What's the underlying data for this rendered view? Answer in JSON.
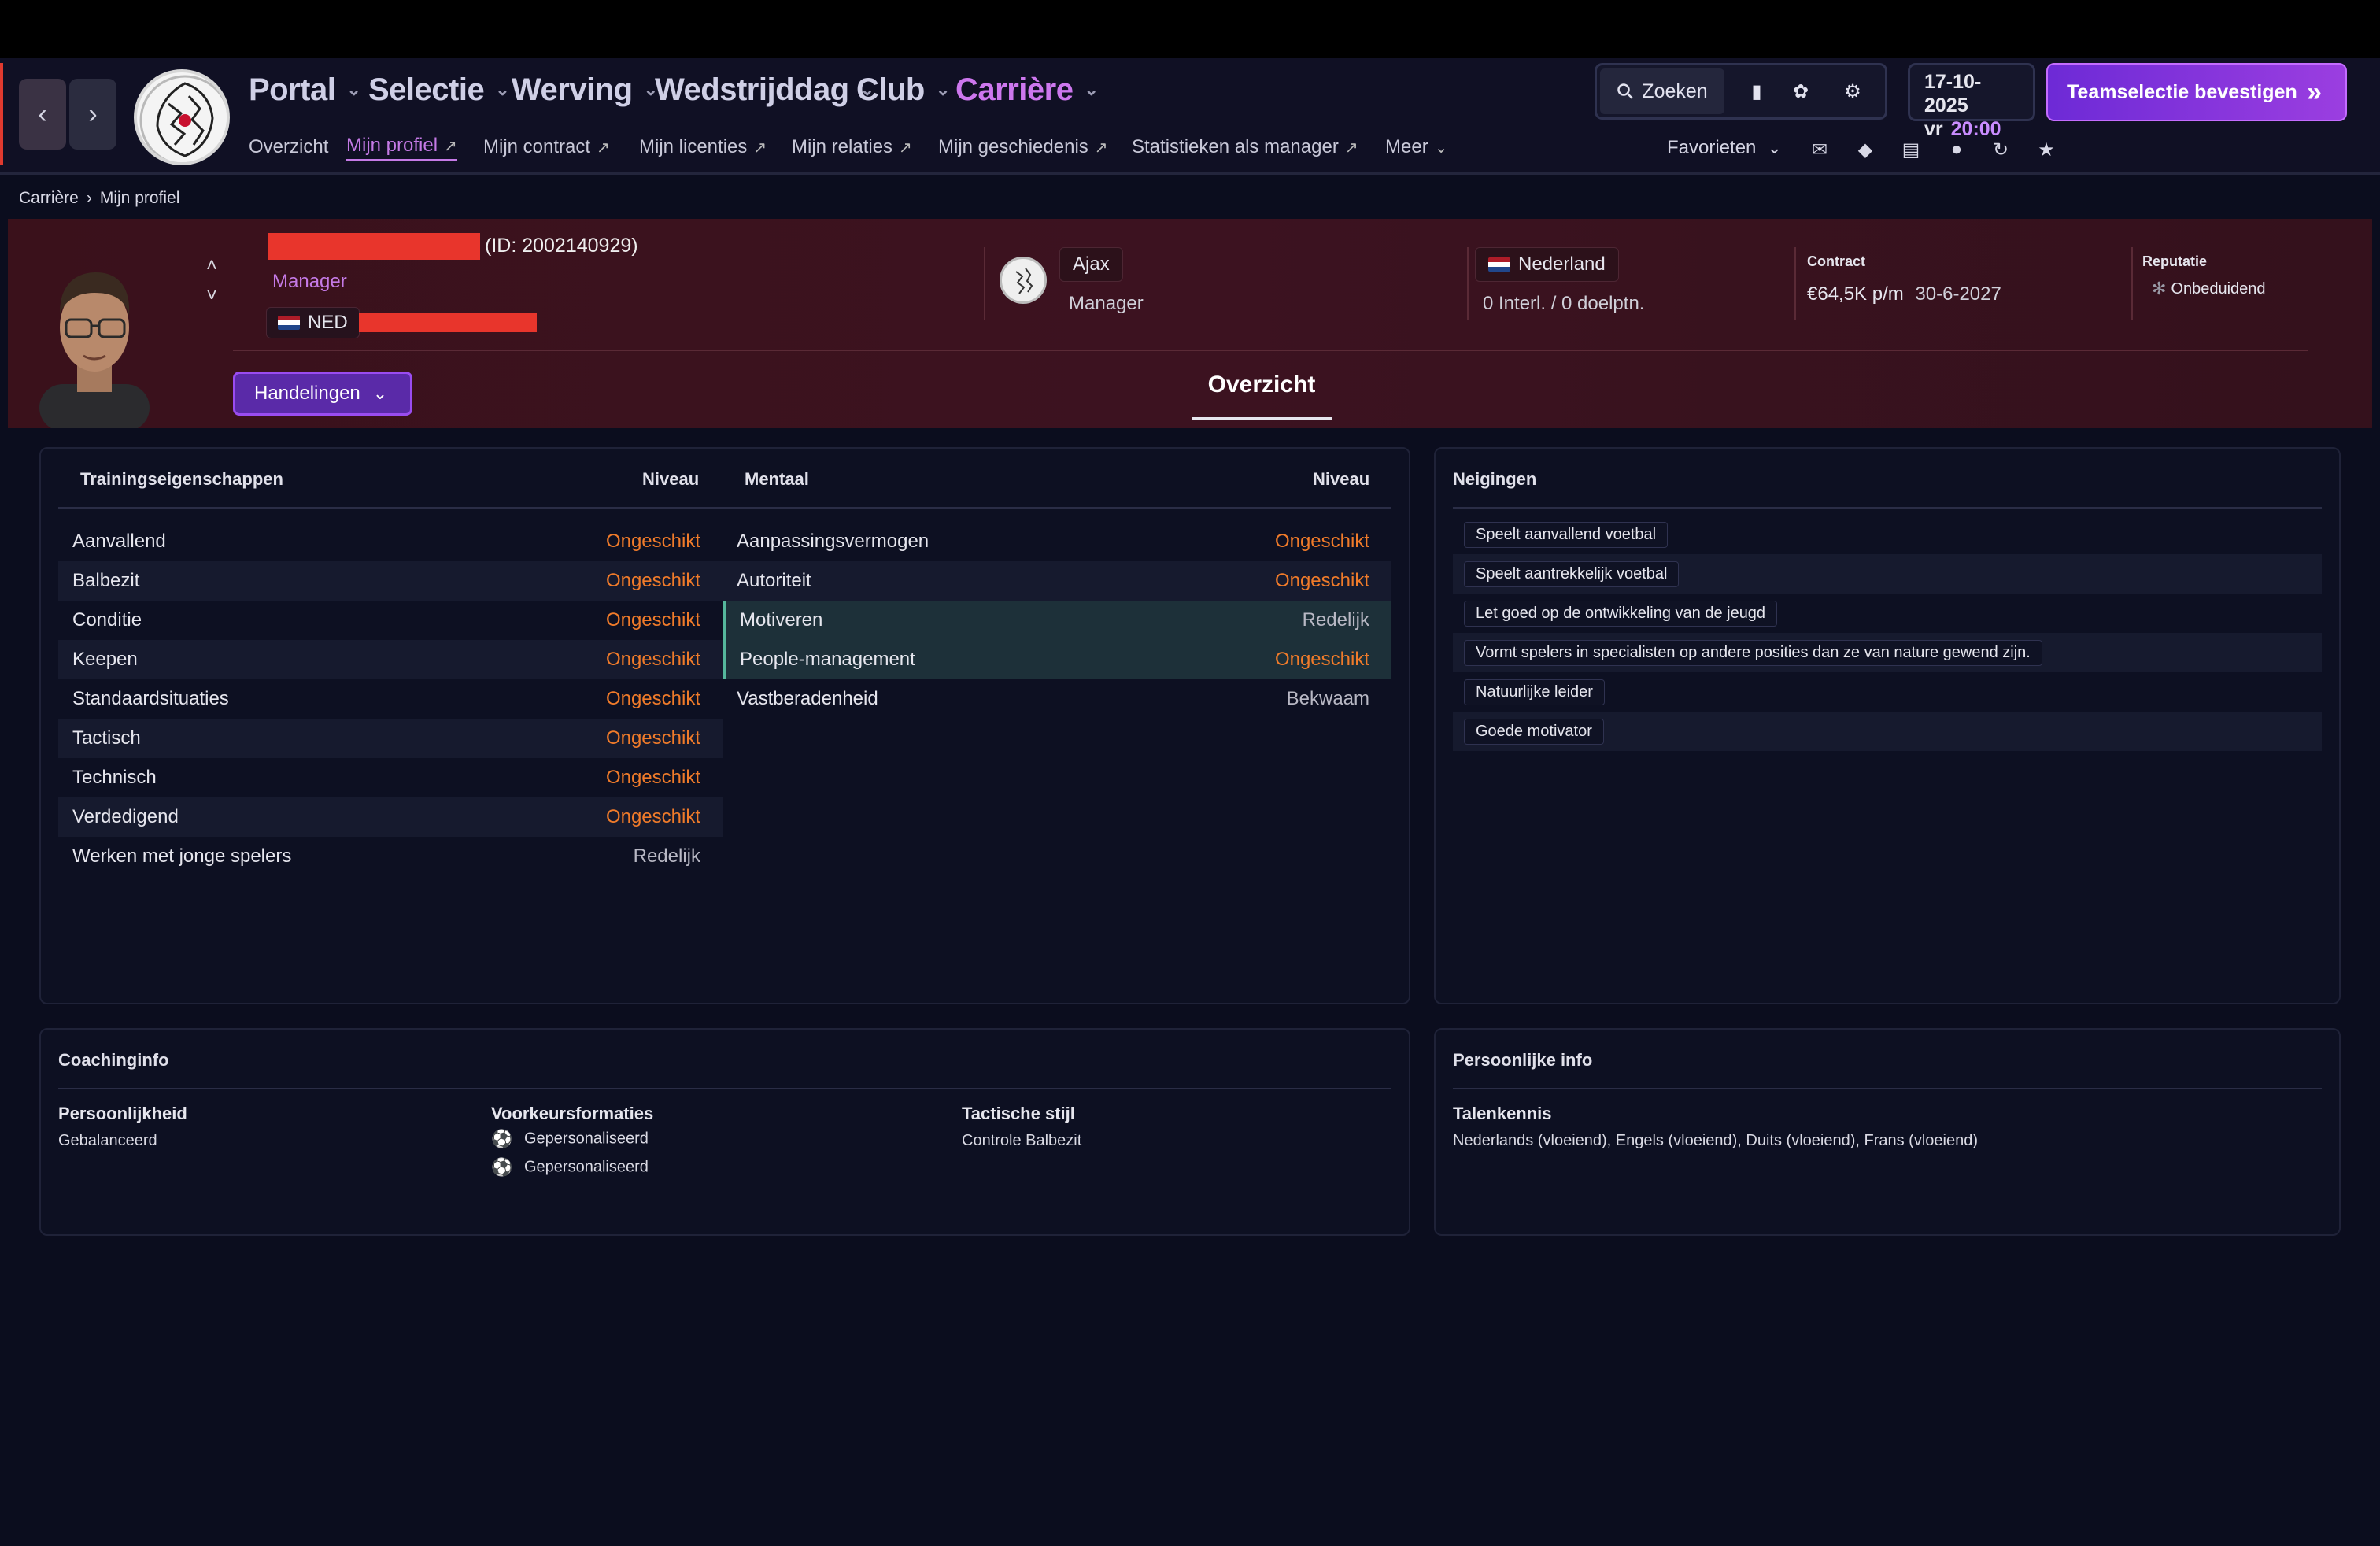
{
  "nav": {
    "main": [
      {
        "label": "Portal"
      },
      {
        "label": "Selectie"
      },
      {
        "label": "Werving"
      },
      {
        "label": "Wedstrijddag"
      },
      {
        "label": "Club"
      },
      {
        "label": "Carrière"
      }
    ],
    "sub": [
      {
        "label": "Overzicht"
      },
      {
        "label": "Mijn profiel"
      },
      {
        "label": "Mijn contract"
      },
      {
        "label": "Mijn licenties"
      },
      {
        "label": "Mijn relaties"
      },
      {
        "label": "Mijn geschiedenis"
      },
      {
        "label": "Statistieken als manager"
      },
      {
        "label": "Meer"
      }
    ]
  },
  "toolbar": {
    "search_label": "Zoeken",
    "date": "17-10-2025",
    "day": "vr",
    "time": "20:00",
    "confirm_label": "Teamselectie bevestigen",
    "favorites_label": "Favorieten"
  },
  "breadcrumb": {
    "parent": "Carrière",
    "current": "Mijn profiel"
  },
  "profile": {
    "id_text": "(ID: 2002140929)",
    "role": "Manager",
    "nationality_code": "NED",
    "club_name": "Ajax",
    "club_role": "Manager",
    "country": "Nederland",
    "caps": "0 Interl. / 0 doelptn.",
    "contract_label": "Contract",
    "contract_value": "€64,5K p/m",
    "contract_end": "30-6-2027",
    "reputation_label": "Reputatie",
    "reputation_value": "Onbeduidend",
    "actions_label": "Handelingen",
    "tab_label": "Overzicht"
  },
  "training": {
    "header": "Trainingseigenschappen",
    "level_header": "Niveau",
    "rows": [
      {
        "name": "Aanvallend",
        "level": "Ongeschikt"
      },
      {
        "name": "Balbezit",
        "level": "Ongeschikt"
      },
      {
        "name": "Conditie",
        "level": "Ongeschikt"
      },
      {
        "name": "Keepen",
        "level": "Ongeschikt"
      },
      {
        "name": "Standaardsituaties",
        "level": "Ongeschikt"
      },
      {
        "name": "Tactisch",
        "level": "Ongeschikt"
      },
      {
        "name": "Technisch",
        "level": "Ongeschikt"
      },
      {
        "name": "Verdedigend",
        "level": "Ongeschikt"
      },
      {
        "name": "Werken met jonge spelers",
        "level": "Redelijk"
      }
    ]
  },
  "mental": {
    "header": "Mentaal",
    "level_header": "Niveau",
    "rows": [
      {
        "name": "Aanpassingsvermogen",
        "level": "Ongeschikt"
      },
      {
        "name": "Autoriteit",
        "level": "Ongeschikt"
      },
      {
        "name": "Motiveren",
        "level": "Redelijk"
      },
      {
        "name": "People-management",
        "level": "Ongeschikt"
      },
      {
        "name": "Vastberadenheid",
        "level": "Bekwaam"
      }
    ]
  },
  "tendencies": {
    "header": "Neigingen",
    "items": [
      "Speelt aanvallend voetbal",
      "Speelt aantrekkelijk voetbal",
      "Let goed op de ontwikkeling van de jeugd",
      "Vormt spelers in specialisten op andere posities dan ze van nature gewend zijn.",
      "Natuurlijke leider",
      "Goede motivator"
    ]
  },
  "coaching": {
    "header": "Coachinginfo",
    "personality_label": "Persoonlijkheid",
    "personality_value": "Gebalanceerd",
    "formations_label": "Voorkeursformaties",
    "formations": [
      "Gepersonaliseerd",
      "Gepersonaliseerd"
    ],
    "style_label": "Tactische stijl",
    "style_value": "Controle Balbezit"
  },
  "personal": {
    "header": "Persoonlijke info",
    "languages_label": "Talenkennis",
    "languages_value": "Nederlands (vloeiend), Engels (vloeiend), Duits (vloeiend), Frans (vloeiend)"
  },
  "colors": {
    "accent_purple": "#c57ae6",
    "level_bad": "#f07b2a",
    "banner": "#3a111b",
    "background": "#0b0d1e"
  }
}
